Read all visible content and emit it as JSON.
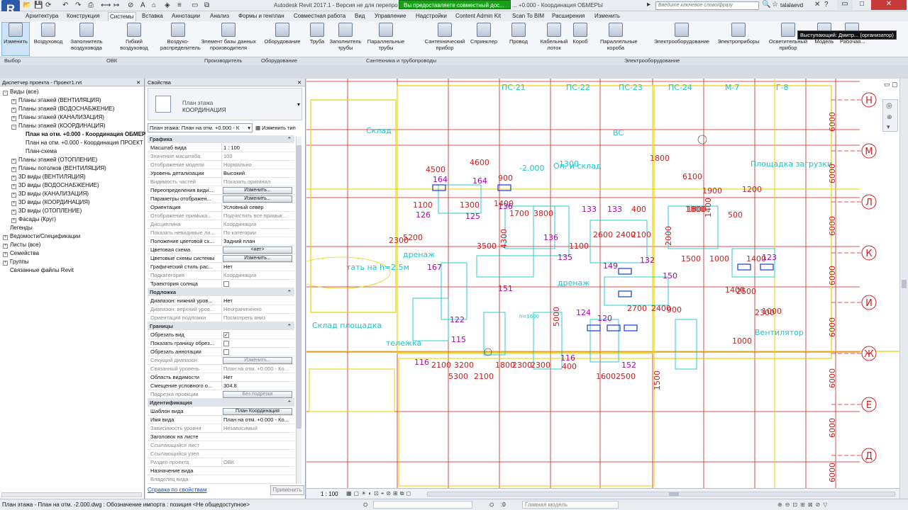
{
  "app": {
    "logo": "R",
    "title": "Autodesk Revit 2017.1 - Версия не для перепро",
    "title_rest": "... +0.000 - Координация ОБМЕРЫ",
    "share_banner": "Вы предоставляете совместный дос...",
    "search_placeholder": "Введите ключевое слово/фразу",
    "user": "talalaevd",
    "tooltip": "Выступающий: Дмитр... (организатор)"
  },
  "menu": [
    "Архитектура",
    "Конструкция",
    "Системы",
    "Вставка",
    "Аннотации",
    "Анализ",
    "Формы и генплан",
    "Совместная работа",
    "Вид",
    "Управление",
    "Надстройки",
    "Content Admin Kit",
    "Scan To BIM",
    "Расширения",
    "Изменить"
  ],
  "ribbon": {
    "buttons": [
      "Изменить",
      "Воздуховод",
      "Заполнитель воздуховода",
      "Гибкий воздуховод",
      "Воздухо-распределитель",
      "Элемент базы данных производителя",
      "Оборудование",
      "Труба",
      "Заполнитель трубы",
      "Параллельные трубы",
      "Сантехнический прибор",
      "Спринклер",
      "Провод",
      "Кабельный лоток",
      "Короб",
      "Параллельные короба",
      "Электрооборудование",
      "Электроприборы",
      "Осветительный прибор",
      "Модель",
      "Рабочая..."
    ],
    "panels": [
      "Выбор",
      "ОВК",
      "Производитель",
      "Оборудование",
      "Сантехника и трубопроводы",
      "Электрооборудование"
    ]
  },
  "browser": {
    "title": "Диспетчер проекта - Проект1.rvt",
    "items": [
      {
        "t": "Виды (все)",
        "lvl": 0,
        "tg": "−"
      },
      {
        "t": "Планы этажей (ВЕНТИЛЯЦИЯ)",
        "lvl": 1,
        "tg": "+"
      },
      {
        "t": "Планы этажей (ВОДОСНАБЖЕНИЕ)",
        "lvl": 1,
        "tg": "+"
      },
      {
        "t": "Планы этажей (КАНАЛИЗАЦИЯ)",
        "lvl": 1,
        "tg": "+"
      },
      {
        "t": "Планы этажей (КООРДИНАЦИЯ)",
        "lvl": 1,
        "tg": "−"
      },
      {
        "t": "План на отм. +0.000 - Координация ОБМЕРЫ",
        "lvl": 2,
        "tg": "",
        "b": true
      },
      {
        "t": "План на отм. +0.000 - Координация ПРОЕКТ",
        "lvl": 2,
        "tg": ""
      },
      {
        "t": "План-схема",
        "lvl": 2,
        "tg": ""
      },
      {
        "t": "Планы этажей (ОТОПЛЕНИЕ)",
        "lvl": 1,
        "tg": "+"
      },
      {
        "t": "Планы потолков (ВЕНТИЛЯЦИЯ)",
        "lvl": 1,
        "tg": "+"
      },
      {
        "t": "3D виды (ВЕНТИЛЯЦИЯ)",
        "lvl": 1,
        "tg": "+"
      },
      {
        "t": "3D виды (ВОДОСНАБЖЕНИЕ)",
        "lvl": 1,
        "tg": "+"
      },
      {
        "t": "3D виды (КАНАЛИЗАЦИЯ)",
        "lvl": 1,
        "tg": "+"
      },
      {
        "t": "3D виды (КООРДИНАЦИЯ)",
        "lvl": 1,
        "tg": "+"
      },
      {
        "t": "3D виды (ОТОПЛЕНИЕ)",
        "lvl": 1,
        "tg": "+"
      },
      {
        "t": "Фасады (Круг)",
        "lvl": 1,
        "tg": "+"
      },
      {
        "t": "Легенды",
        "lvl": 0,
        "tg": ""
      },
      {
        "t": "Ведомости/Спецификации",
        "lvl": 0,
        "tg": "+"
      },
      {
        "t": "Листы (все)",
        "lvl": 0,
        "tg": "+"
      },
      {
        "t": "Семейства",
        "lvl": 0,
        "tg": "+"
      },
      {
        "t": "Группы",
        "lvl": 0,
        "tg": "+"
      },
      {
        "t": "Связанные файлы Revit",
        "lvl": 0,
        "tg": ""
      }
    ]
  },
  "props": {
    "title": "Свойства",
    "type_line1": "План этажа",
    "type_line2": "КООРДИНАЦИЯ",
    "selector": "План этажа: План на отм. +0.000 - К",
    "edit_type": "Изменить тип",
    "help": "Справка по свойствам",
    "apply": "Применить",
    "rows": [
      {
        "s": "Графика"
      },
      {
        "k": "Масштаб вида",
        "v": "1 : 100"
      },
      {
        "k": "Значение масштаба",
        "v": "100",
        "d": 1
      },
      {
        "k": "Отображение модели",
        "v": "Нормально",
        "d": 1
      },
      {
        "k": "Уровень детализации",
        "v": "Высокий"
      },
      {
        "k": "Видимость частей",
        "v": "Показать оригинал",
        "d": 1
      },
      {
        "k": "Переопределения види...",
        "b": "Изменить..."
      },
      {
        "k": "Параметры отображен...",
        "b": "Изменить..."
      },
      {
        "k": "Ориентация",
        "v": "Условный север"
      },
      {
        "k": "Отображение примыка...",
        "v": "Подчистить все примык...",
        "d": 1
      },
      {
        "k": "Дисциплина",
        "v": "Координация",
        "d": 1
      },
      {
        "k": "Показать невидимые ли...",
        "v": "По категории",
        "d": 1
      },
      {
        "k": "Положение цветовой сх...",
        "v": "Задний план"
      },
      {
        "k": "Цветовая схема",
        "b": "<нет>"
      },
      {
        "k": "Цветовые схемы системы",
        "b": "Изменить..."
      },
      {
        "k": "Графический стиль рас...",
        "v": "Нет"
      },
      {
        "k": "Подкатегория",
        "v": "Координация",
        "d": 1
      },
      {
        "k": "Траектория солнца",
        "c": false
      },
      {
        "s": "Подложка"
      },
      {
        "k": "Диапазон: нижний уров...",
        "v": "Нет"
      },
      {
        "k": "Диапазон: верхний уров...",
        "v": "Неограниченно",
        "d": 1
      },
      {
        "k": "Ориентация подложки",
        "v": "Посмотреть вниз",
        "d": 1
      },
      {
        "s": "Границы"
      },
      {
        "k": "Обрезать вид",
        "c": true
      },
      {
        "k": "Показать границу обрез...",
        "c": false
      },
      {
        "k": "Обрезать аннотации",
        "c": false
      },
      {
        "k": "Секущий диапазон",
        "b": "Изменить...",
        "d": 1
      },
      {
        "k": "Связанный уровень",
        "v": "План на отм. +0.000 - Ко...",
        "d": 1
      },
      {
        "k": "Область видимости",
        "v": "Нет"
      },
      {
        "k": "Смещение условного о...",
        "v": "304.8"
      },
      {
        "k": "Подрезка проекции",
        "b": "Без подрезки",
        "d": 1
      },
      {
        "s": "Идентификация"
      },
      {
        "k": "Шаблон вида",
        "b": "План Координация"
      },
      {
        "k": "Имя вида",
        "v": "План на отм. +0.000 - Ко..."
      },
      {
        "k": "Зависимость уровня",
        "v": "Независимый",
        "d": 1
      },
      {
        "k": "Заголовок на листе",
        "v": ""
      },
      {
        "k": "Ссылающийся лист",
        "v": "",
        "d": 1
      },
      {
        "k": "Ссылающийся узел",
        "v": "",
        "d": 1
      },
      {
        "k": "Раздел проекта",
        "v": "ОВК",
        "d": 1
      },
      {
        "k": "Назначение вида",
        "v": ""
      },
      {
        "k": "Владелец вида",
        "v": "",
        "d": 1
      }
    ]
  },
  "drawing": {
    "grid_right": [
      "Н",
      "М",
      "Л",
      "К",
      "И",
      "Ж",
      "Е",
      "Д"
    ],
    "room_labels": [
      "Склад",
      "ВС",
      "Площадка загрузки",
      "ПС-21",
      "ПС-22",
      "ПС-23",
      "ПС-24",
      "М-7",
      "Г-8",
      "дренаж",
      "дренаж",
      "Вентилятор",
      "тележка",
      "Склад площадка",
      "тать на h=2.5м",
      "Оп. и склад",
      "h=1600"
    ],
    "dims_red": [
      "4600",
      "900",
      "1800",
      "6100",
      "1900",
      "1200",
      "1800",
      "1100",
      "1300",
      "1400",
      "1700",
      "3800",
      "400",
      "1800",
      "2600",
      "2400",
      "2100",
      "1100",
      "1500",
      "1000",
      "1400",
      "1400",
      "2500",
      "2300",
      "1000",
      "900",
      "2700",
      "2400",
      "3500",
      "5200",
      "4500",
      "2300",
      "2100",
      "3200",
      "1800",
      "2300",
      "2300",
      "5300",
      "2100",
      "1600",
      "2500",
      "400",
      "1400",
      "500",
      "1000",
      "6000",
      "6000",
      "6000",
      "6000",
      "6000",
      "6000",
      "6000",
      "6000",
      "5000",
      "4300",
      "2000",
      "1500"
    ],
    "dims_mag": [
      "164",
      "164",
      "126",
      "125",
      "136",
      "136",
      "133",
      "133",
      "132",
      "135",
      "149",
      "150",
      "151",
      "167",
      "124",
      "122",
      "115",
      "116",
      "116",
      "152",
      "123",
      "120"
    ],
    "dims_cyan": [
      "-2.000",
      "1300"
    ]
  },
  "viewbar": {
    "scale": "1 : 100"
  },
  "status": {
    "text": "План этажа - План на отм. -2.000.dwg : Обозначение импорта : позиция <Не общедоступное>",
    "coord": ":0",
    "model": "Главная модель"
  }
}
